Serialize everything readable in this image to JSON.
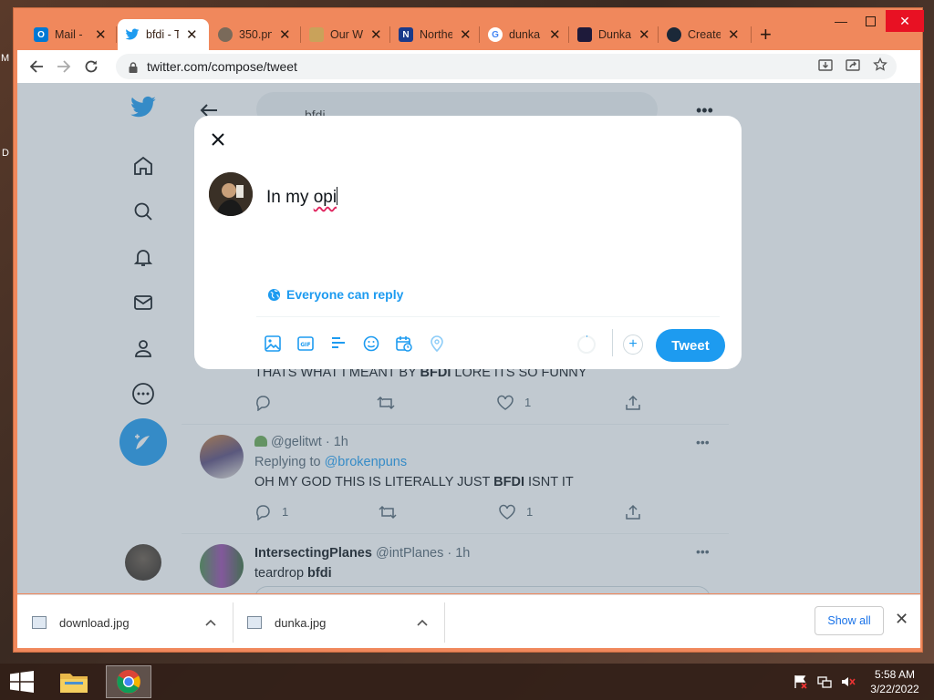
{
  "desktop": {
    "edge_glyph_top": "M",
    "edge_glyph_mid": "D"
  },
  "tabs": [
    {
      "title": "Mail -",
      "icon": "outlook-icon",
      "color": "#0078d4",
      "glyph": "O"
    },
    {
      "title": "bfdi - T",
      "icon": "twitter-icon",
      "color": "#1d9bf0",
      "glyph": "",
      "active": true
    },
    {
      "title": "350.pn",
      "icon": "globe-icon",
      "color": "#7a6a5a",
      "glyph": ""
    },
    {
      "title": "Our W",
      "icon": "scroll-icon",
      "color": "#c9a25a",
      "glyph": ""
    },
    {
      "title": "Northe",
      "icon": "northeastern-icon",
      "color": "#1a3a8a",
      "glyph": "N"
    },
    {
      "title": "dunka",
      "icon": "google-icon",
      "color": "#ffffff",
      "glyph": "G"
    },
    {
      "title": "Dunka",
      "icon": "knowyourmeme-icon",
      "color": "#1e1a3a",
      "glyph": ""
    },
    {
      "title": "Create",
      "icon": "steam-icon",
      "color": "#1b2838",
      "glyph": ""
    }
  ],
  "address": {
    "url": "twitter.com/compose/tweet"
  },
  "feed": {
    "search_query": "bfdi",
    "tweet1_text_pre": "THATS WHAT I MEANT BY ",
    "tweet1_bold": "BFDI",
    "tweet1_text_post": " LORE ITS SO FUNNY",
    "tweet1_likes": "1",
    "tweet2_handle": "@gelitwt",
    "tweet2_time": "· 1h",
    "tweet2_replying_label": "Replying to",
    "tweet2_replying_to": "@brokenpuns",
    "tweet2_text_pre": "OH MY GOD THIS IS LITERALLY JUST ",
    "tweet2_bold": "BFDI",
    "tweet2_text_post": " ISNT IT",
    "tweet2_replies": "1",
    "tweet2_likes": "1",
    "tweet3_name": "IntersectingPlanes",
    "tweet3_handle": "@intPlanes",
    "tweet3_time": "· 1h",
    "tweet3_text_pre": "teardrop ",
    "tweet3_bold": "bfdi"
  },
  "compose": {
    "text_plain": "In my ",
    "text_misspelled": "opi",
    "reply_setting": "Everyone can reply",
    "tweet_button": "Tweet"
  },
  "downloads": {
    "items": [
      {
        "filename": "download.jpg"
      },
      {
        "filename": "dunka.jpg"
      }
    ],
    "show_all": "Show all"
  },
  "taskbar": {
    "time": "5:58 AM",
    "date": "3/22/2022"
  },
  "colors": {
    "twitter_blue": "#1d9bf0",
    "window_frame": "#f0885c"
  }
}
